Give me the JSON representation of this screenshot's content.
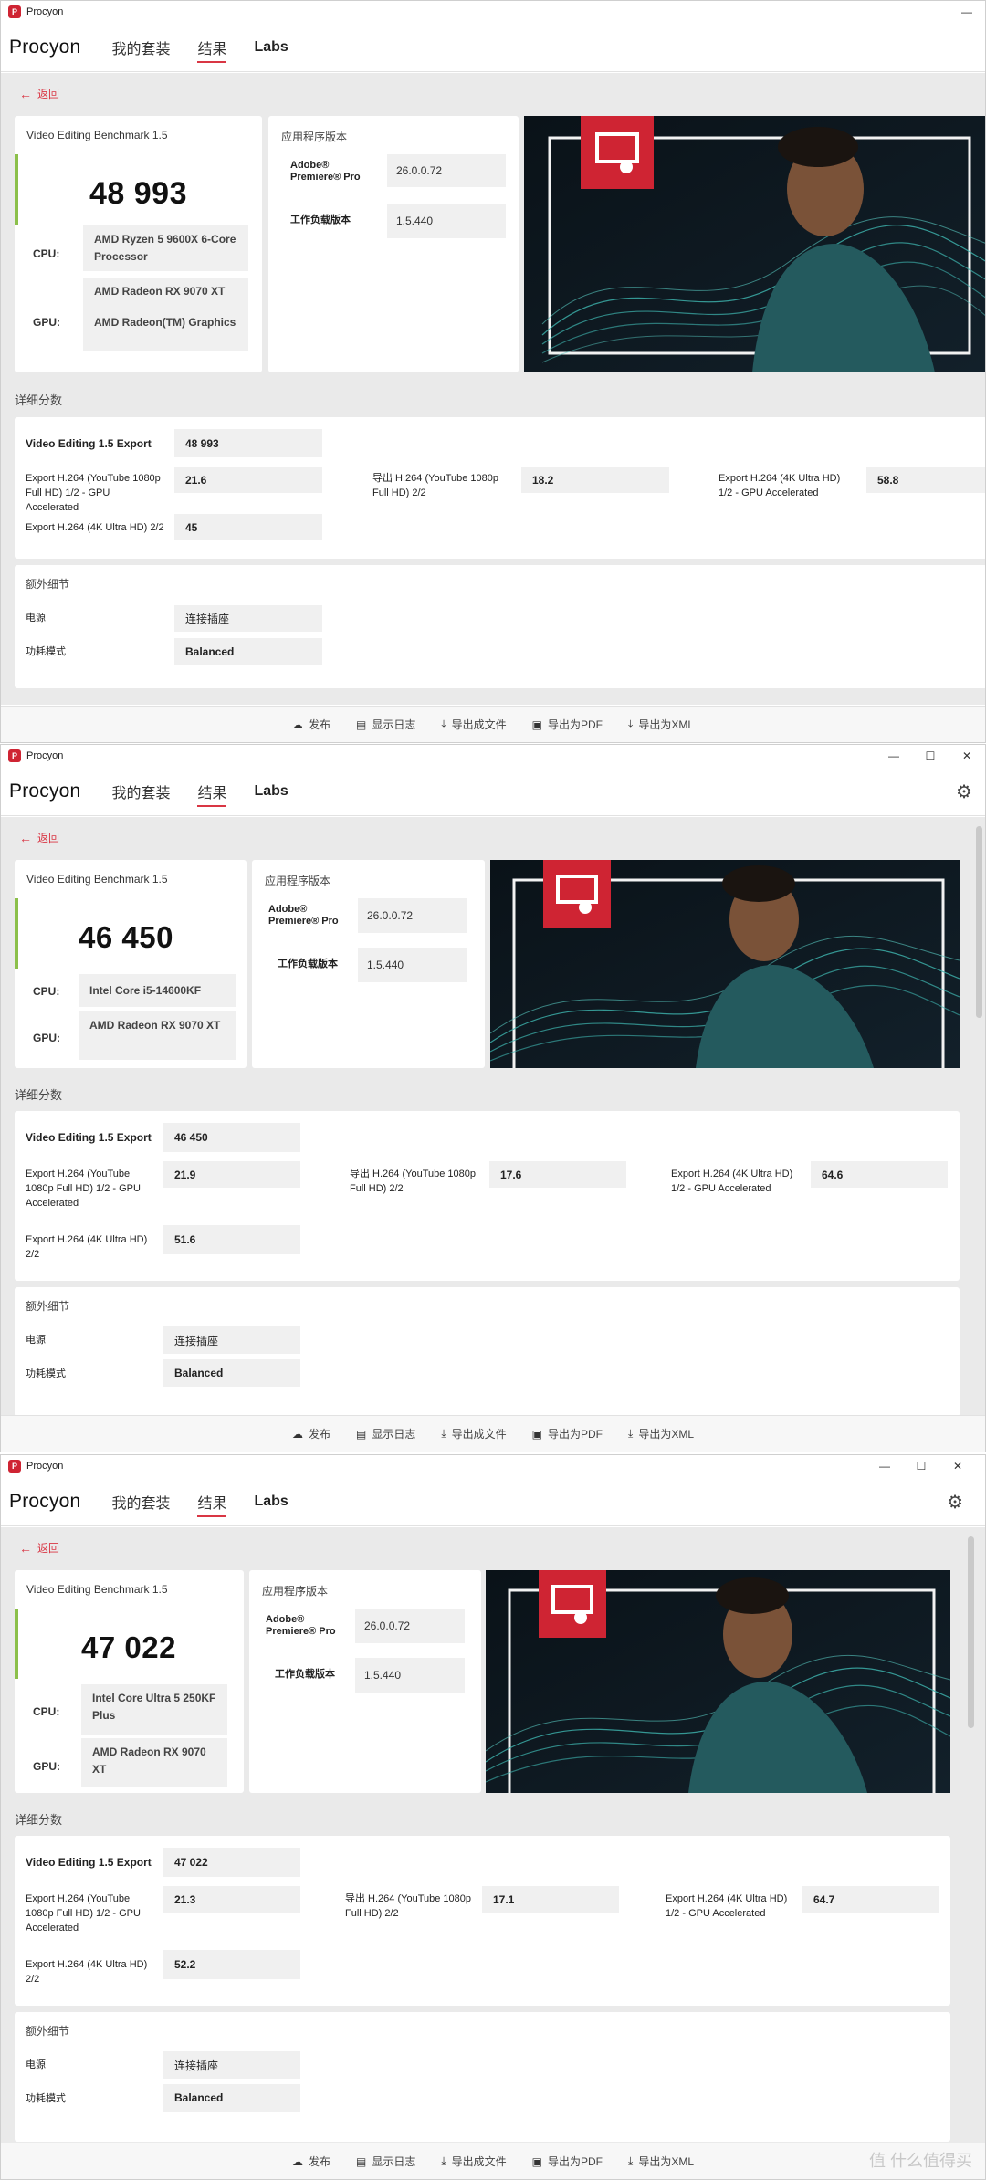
{
  "app": {
    "title": "Procyon",
    "logo_letter": "P",
    "brand": "Procyon",
    "accent": "#d93644",
    "score_bar": "#8cc04b"
  },
  "window_controls": {
    "minimize": "—",
    "maximize": "☐",
    "close": "✕"
  },
  "nav": {
    "my_suites": "我的套装",
    "results": "结果",
    "labs": "Labs"
  },
  "back": "返回",
  "labels": {
    "cpu": "CPU:",
    "gpu": "GPU:",
    "app_version": "应用程序版本",
    "premiere": "Adobe® Premiere® Pro",
    "workload": "工作负载版本",
    "detailed": "详细分数",
    "extra": "额外细节",
    "power": "电源",
    "power_mode": "功耗模式"
  },
  "footer": {
    "publish": "发布",
    "log": "显示日志",
    "export_file": "导出成文件",
    "export_pdf": "导出为PDF",
    "export_xml": "导出为XML"
  },
  "watermark": "值 什么值得买",
  "results": [
    {
      "benchmark": "Video Editing Benchmark 1.5",
      "score": "48 993",
      "cpu": "AMD Ryzen 5 9600X 6-Core Processor",
      "gpu1": "AMD Radeon RX 9070 XT",
      "gpu2": "AMD Radeon(TM) Graphics",
      "premiere_version": "26.0.0.72",
      "workload_version": "1.5.440",
      "export_label": "Video Editing 1.5 Export",
      "export_score": "48 993",
      "t1_label": "Export H.264 (YouTube 1080p Full HD) 1/2 - GPU Accelerated",
      "t1": "21.6",
      "t2_label": "导出 H.264 (YouTube 1080p Full HD) 2/2",
      "t2": "18.2",
      "t3_label": "Export H.264 (4K Ultra HD) 1/2 - GPU Accelerated",
      "t3": "58.8",
      "t4_label": "Export H.264 (4K Ultra HD) 2/2",
      "t4": "45",
      "power": "连接插座",
      "power_mode": "Balanced"
    },
    {
      "benchmark": "Video Editing Benchmark 1.5",
      "score": "46 450",
      "cpu": "Intel Core i5-14600KF",
      "gpu1": "AMD Radeon RX 9070 XT",
      "premiere_version": "26.0.0.72",
      "workload_version": "1.5.440",
      "export_label": "Video Editing 1.5 Export",
      "export_score": "46 450",
      "t1_label": "Export H.264 (YouTube 1080p Full HD) 1/2 - GPU Accelerated",
      "t1": "21.9",
      "t2_label": "导出 H.264 (YouTube 1080p Full HD) 2/2",
      "t2": "17.6",
      "t3_label": "Export H.264 (4K Ultra HD) 1/2 - GPU Accelerated",
      "t3": "64.6",
      "t4_label": "Export H.264 (4K Ultra HD) 2/2",
      "t4": "51.6",
      "power": "连接插座",
      "power_mode": "Balanced"
    },
    {
      "benchmark": "Video Editing Benchmark 1.5",
      "score": "47 022",
      "cpu": "Intel Core Ultra 5 250KF Plus",
      "gpu1": "AMD Radeon RX 9070 XT",
      "premiere_version": "26.0.0.72",
      "workload_version": "1.5.440",
      "export_label": "Video Editing 1.5 Export",
      "export_score": "47 022",
      "t1_label": "Export H.264 (YouTube 1080p Full HD) 1/2 - GPU Accelerated",
      "t1": "21.3",
      "t2_label": "导出 H.264 (YouTube 1080p Full HD) 2/2",
      "t2": "17.1",
      "t3_label": "Export H.264 (4K Ultra HD) 1/2 - GPU Accelerated",
      "t3": "64.7",
      "t4_label": "Export H.264 (4K Ultra HD) 2/2",
      "t4": "52.2",
      "power": "连接插座",
      "power_mode": "Balanced"
    }
  ]
}
